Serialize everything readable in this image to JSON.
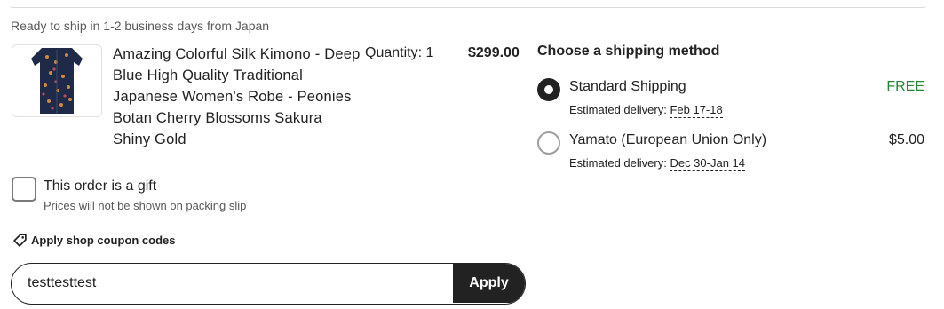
{
  "ship_note": "Ready to ship in 1-2 business days from Japan",
  "item": {
    "title": "Amazing Colorful Silk Kimono - Deep Blue High Quality Traditional Japanese Women's Robe - Peonies Botan Cherry Blossoms Sakura Shiny Gold",
    "quantity": "Quantity: 1",
    "price": "$299.00",
    "image_icon": "kimono-thumbnail"
  },
  "shipping": {
    "heading": "Choose a shipping method",
    "options": [
      {
        "name": "Standard Shipping",
        "estimate_label": "Estimated delivery:",
        "estimate_date": "Feb 17-18",
        "price": "FREE",
        "selected": true
      },
      {
        "name": "Yamato (European Union Only)",
        "estimate_label": "Estimated delivery:",
        "estimate_date": "Dec 30-Jan 14",
        "price": "$5.00",
        "selected": false
      }
    ]
  },
  "gift": {
    "label": "This order is a gift",
    "sublabel": "Prices will not be shown on packing slip",
    "checked": false
  },
  "coupon": {
    "link_label": "Apply shop coupon codes",
    "icon": "tag-icon",
    "input_value": "testtesttest",
    "apply_label": "Apply"
  },
  "colors": {
    "free": "#258635",
    "dark": "#222222",
    "muted": "#595959"
  }
}
